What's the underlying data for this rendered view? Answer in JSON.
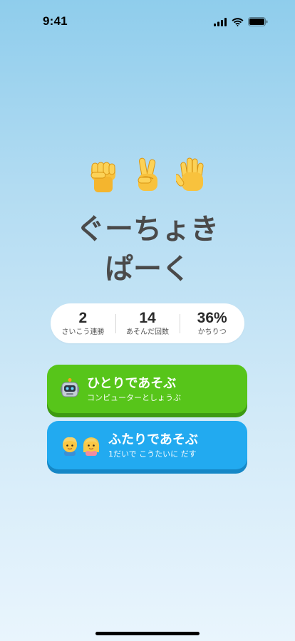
{
  "status": {
    "time": "9:41"
  },
  "hands": [
    {
      "icon": "raised-fist-icon"
    },
    {
      "icon": "victory-hand-icon"
    },
    {
      "icon": "raised-hand-icon"
    }
  ],
  "title": {
    "line1": "ぐーちょき",
    "line2": "ぱーく"
  },
  "stats": [
    {
      "value": "2",
      "label": "さいこう連勝"
    },
    {
      "value": "14",
      "label": "あそんだ回数"
    },
    {
      "value": "36%",
      "label": "かちりつ"
    }
  ],
  "modes": {
    "solo": {
      "title": "ひとりであそぶ",
      "subtitle": "コンピューターとしょうぶ",
      "icon": "robot-icon",
      "color": "#57c51a"
    },
    "duo": {
      "title": "ふたりであそぶ",
      "subtitle": "1だいで こうたいに だす",
      "icons": [
        "boy-icon",
        "girl-icon"
      ],
      "color": "#22aaf0"
    }
  }
}
